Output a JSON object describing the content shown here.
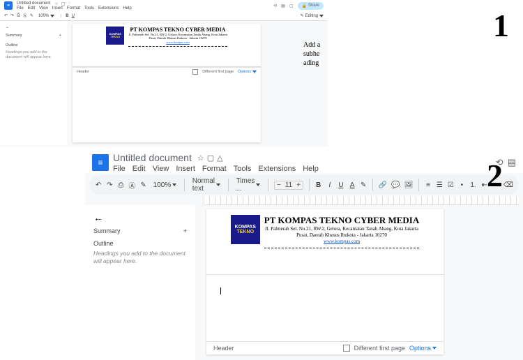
{
  "doc_title": "Untitled document",
  "menus": [
    "File",
    "Edit",
    "View",
    "Insert",
    "Format",
    "Tools",
    "Extensions",
    "Help"
  ],
  "share_label": "Share",
  "editing_label": "Editing",
  "toolbar": {
    "zoom": "100%",
    "style": "Normal text",
    "font": "Times ...",
    "size": "11"
  },
  "outline": {
    "summary": "Summary",
    "outline": "Outline",
    "hint": "Headings you add to the document will appear here."
  },
  "letterhead": {
    "logo_line1": "KOMPAS",
    "logo_line2": "TEKNO",
    "company": "PT KOMPAS TEKNO CYBER MEDIA",
    "addr1": "Jl. Palmerah Sel. No.21, RW.2, Gelora, Kecamatan Tanah Abang, Kota Jakarta",
    "addr2": "Pusat, Daerah Khusus Ibukota - Jakarta 10270",
    "url": "www.kompas.com"
  },
  "header_bar": {
    "label": "Header",
    "diff_first": "Different first page",
    "options": "Options"
  },
  "steps": {
    "n1": "1",
    "n2": "2"
  },
  "caption1": "Add a\nsubhe\nading"
}
